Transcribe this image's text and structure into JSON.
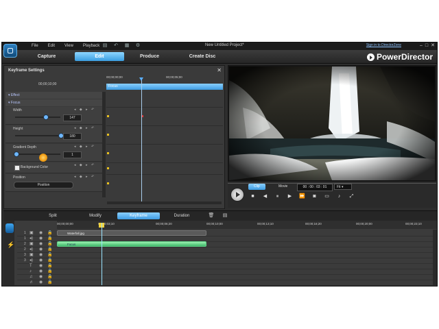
{
  "window": {
    "menu": [
      "File",
      "Edit",
      "View",
      "Playback"
    ],
    "project_title": "New Untitled Project*",
    "signin_link": "Sign in to DirectorZone",
    "window_buttons": [
      "–",
      "□",
      "✕"
    ]
  },
  "modes": {
    "tabs": [
      "Capture",
      "Edit",
      "Produce",
      "Create Disc"
    ],
    "active": "Edit",
    "brand": "PowerDirector"
  },
  "keyframe_panel": {
    "title": "Keyframe Settings",
    "current_time": "00;00;10;00",
    "ruler": [
      "00;00;00;00",
      "00;00;05;00"
    ],
    "track_label": "Focus",
    "sections": {
      "effect": "Effect",
      "focus": "Focus"
    },
    "properties": [
      {
        "label": "Width",
        "value": "147",
        "level": 0.66
      },
      {
        "label": "Height",
        "value": "180",
        "level": 1.0
      },
      {
        "label": "Gradient Depth",
        "value": "1",
        "level": 0.02
      },
      {
        "label": "Background Color"
      },
      {
        "label": "Position",
        "button": "Position"
      }
    ]
  },
  "preview": {
    "clip_tab": "Clip",
    "movie_tab": "Movie",
    "timecode": "00 : 00 : 03 : 01",
    "fit": "Fit"
  },
  "edit_bar": {
    "buttons": [
      "Split",
      "Modify",
      "Keyframe",
      "Duration"
    ],
    "active": "Keyframe"
  },
  "timeline": {
    "ruler": [
      "00;00;00;00",
      "00;00;03;10",
      "00;00;06;20",
      "00;00;10;00",
      "00;00;13;10",
      "00;00;16;20",
      "00;00;20;00",
      "00;00;23;10"
    ],
    "rows": [
      "1",
      "1",
      "2",
      "2",
      "3",
      "3",
      "",
      "",
      "",
      ""
    ],
    "clips": {
      "video": "Waterfall.jpg",
      "effect": "Focus"
    }
  },
  "colors": {
    "accent": "#3e9be0",
    "effect_clip": "#3fb86a",
    "keyframe_marker": "#e8c020",
    "playhead": "#9be4ff"
  }
}
